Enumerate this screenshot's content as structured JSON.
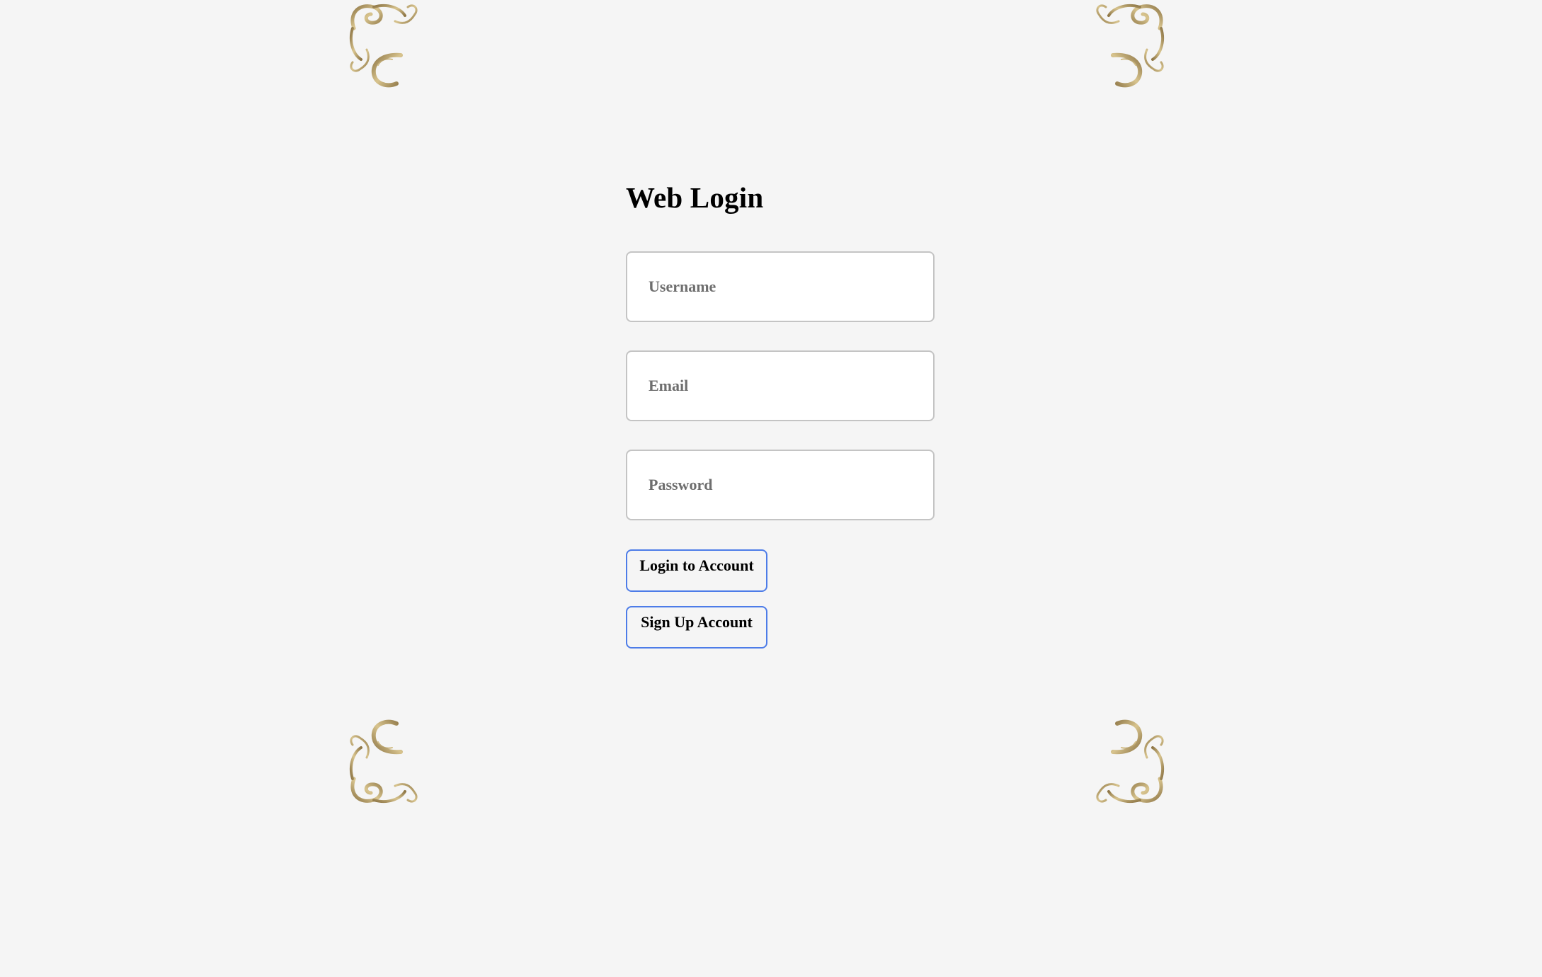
{
  "theme": {
    "background": "#f5f5f5",
    "frame_gold": "#a8915e",
    "frame_highlight": "#f3e6b3",
    "button_border": "#4d7ce8",
    "field_border": "#c4c4c4"
  },
  "frame": {
    "icon": "ornate-gold-border-icon"
  },
  "login": {
    "title": "Web Login",
    "username": {
      "placeholder": "Username",
      "value": ""
    },
    "email": {
      "placeholder": "Email",
      "value": ""
    },
    "password": {
      "placeholder": "Password",
      "value": ""
    },
    "login_button": "Login to Account",
    "signup_button": "Sign Up Account"
  }
}
